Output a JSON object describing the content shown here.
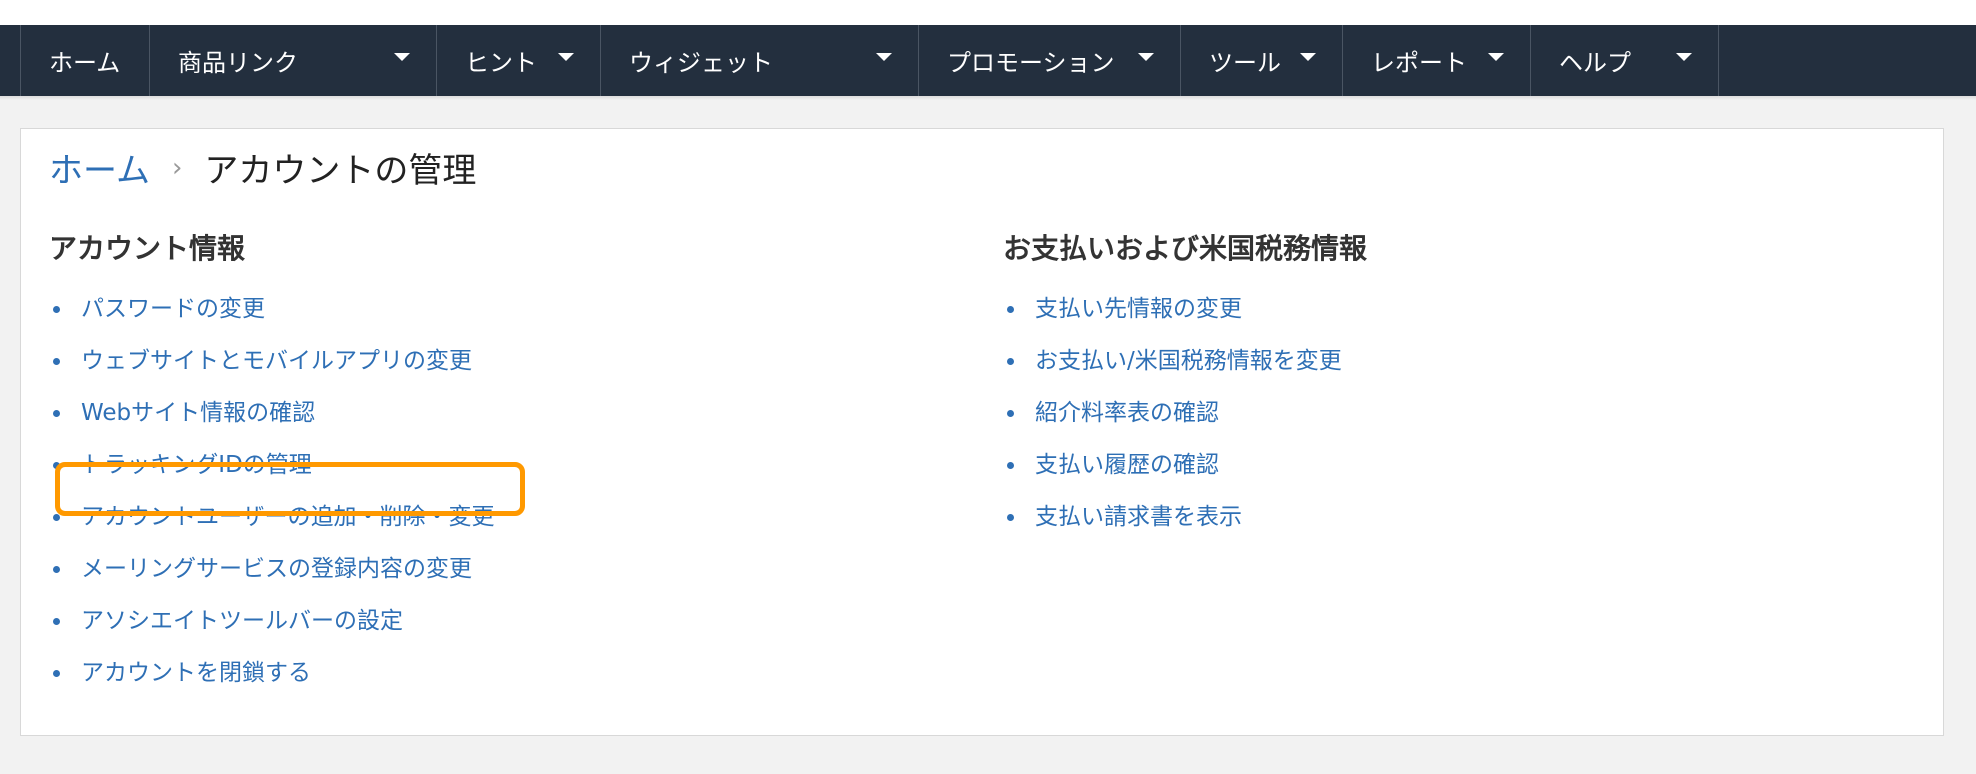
{
  "nav": {
    "items": [
      {
        "label": "ホーム",
        "dropdown": false
      },
      {
        "label": "商品リンク",
        "dropdown": true
      },
      {
        "label": "ヒント",
        "dropdown": true
      },
      {
        "label": "ウィジェット",
        "dropdown": true
      },
      {
        "label": "プロモーション",
        "dropdown": true
      },
      {
        "label": "ツール",
        "dropdown": true
      },
      {
        "label": "レポート",
        "dropdown": true
      },
      {
        "label": "ヘルプ",
        "dropdown": true
      }
    ]
  },
  "breadcrumb": {
    "home": "ホーム",
    "separator": "›",
    "current": "アカウントの管理"
  },
  "account_info": {
    "heading": "アカウント情報",
    "links": [
      "パスワードの変更",
      "ウェブサイトとモバイルアプリの変更",
      "Webサイト情報の確認",
      "トラッキングIDの管理",
      "アカウントユーザーの追加・削除・変更",
      "メーリングサービスの登録内容の変更",
      "アソシエイトツールバーの設定",
      "アカウントを閉鎖する"
    ]
  },
  "payment_info": {
    "heading": "お支払いおよび米国税務情報",
    "links": [
      "支払い先情報の変更",
      "お支払い/米国税務情報を変更",
      "紹介料率表の確認",
      "支払い履歴の確認",
      "支払い請求書を表示"
    ]
  },
  "colors": {
    "nav_bg": "#232f3e",
    "link": "#2e6fb5",
    "highlight": "#ff9900"
  }
}
